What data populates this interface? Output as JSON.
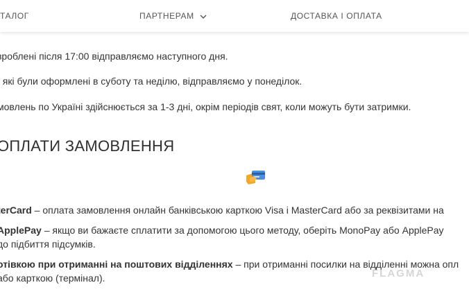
{
  "nav": {
    "items": [
      {
        "label": "ТАЛОГ"
      },
      {
        "label": "ПАРТНЕРАМ"
      },
      {
        "label": "ДОСТАВКА І ОПЛАТА"
      }
    ]
  },
  "delivery": {
    "line_1": "зроблені після 17:00 відправляємо наступного дня.",
    "line_2": ", які були оформлені в суботу та неділю, відправляємо у понеділок.",
    "line_3": "мовлень по Україні здійснюється за 1-3 дні, окрім періодів свят, коли можуть бути затримки."
  },
  "payment": {
    "heading": "ОПЛАТИ ЗАМОВЛЕННЯ",
    "icon": "credit-card-payment-icon",
    "items": [
      {
        "bold": "terCard",
        "text": " – оплата замовлення онлайн банківською карткою Visa і MasterCard або за реквізитами на"
      },
      {
        "bold": "ApplePay",
        "text": " – якщо ви бажаєте сплатити за допомогою цього методу, оберіть MonoPay або ApplePay"
      },
      {
        "text": "до підбиття підсумків."
      },
      {
        "bold": "отівкою при отриманні на поштових відділеннях",
        "text": " – при отриманні посилки на відділенні можна опл"
      },
      {
        "text": "або карткою (термінал)."
      }
    ]
  },
  "watermark": "FLAGMA",
  "colors": {
    "text": "#333333",
    "nav_text": "#555555",
    "icon_orange": "#f5a623",
    "icon_blue": "#4a90e2"
  }
}
